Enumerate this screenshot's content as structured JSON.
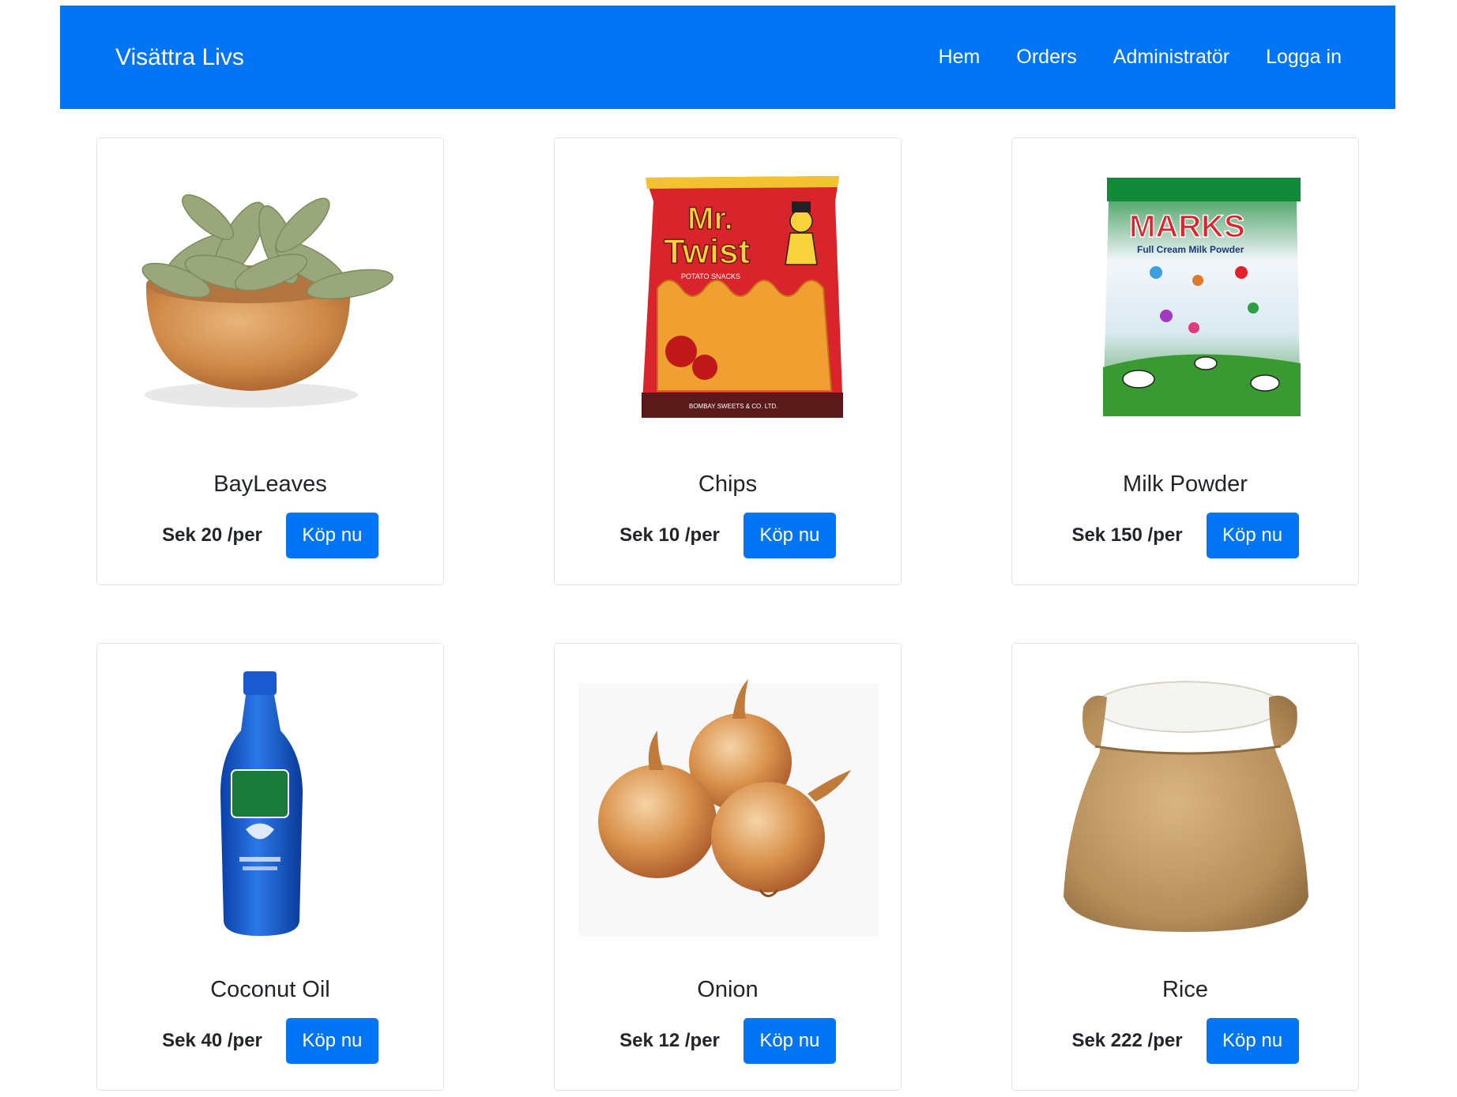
{
  "navbar": {
    "brand": "Visättra Livs",
    "links": [
      "Hem",
      "Orders",
      "Administratör",
      "Logga in"
    ],
    "color": "#0275f4"
  },
  "products": [
    {
      "name": "BayLeaves",
      "price": "Sek 20 /per",
      "button": "Köp nu",
      "image": "bay-leaves-bowl"
    },
    {
      "name": "Chips",
      "price": "Sek 10 /per",
      "button": "Köp nu",
      "image": "chips-bag"
    },
    {
      "name": "Milk Powder",
      "price": "Sek 150 /per",
      "button": "Köp nu",
      "image": "milk-powder-pack"
    },
    {
      "name": "Coconut Oil",
      "price": "Sek 40 /per",
      "button": "Köp nu",
      "image": "coconut-oil-bottle"
    },
    {
      "name": "Onion",
      "price": "Sek 12 /per",
      "button": "Köp nu",
      "image": "onions"
    },
    {
      "name": "Rice",
      "price": "Sek 222 /per",
      "button": "Köp nu",
      "image": "rice-sack"
    }
  ],
  "image_text": {
    "chips_logo_1": "Mr.",
    "chips_logo_2": "Twist",
    "chips_sub": "POTATO SNACKS",
    "chips_maker": "BOMBAY SWEETS & CO. LTD.",
    "milk_brand": "MARKS",
    "milk_sub": "Full Cream Milk Powder"
  }
}
